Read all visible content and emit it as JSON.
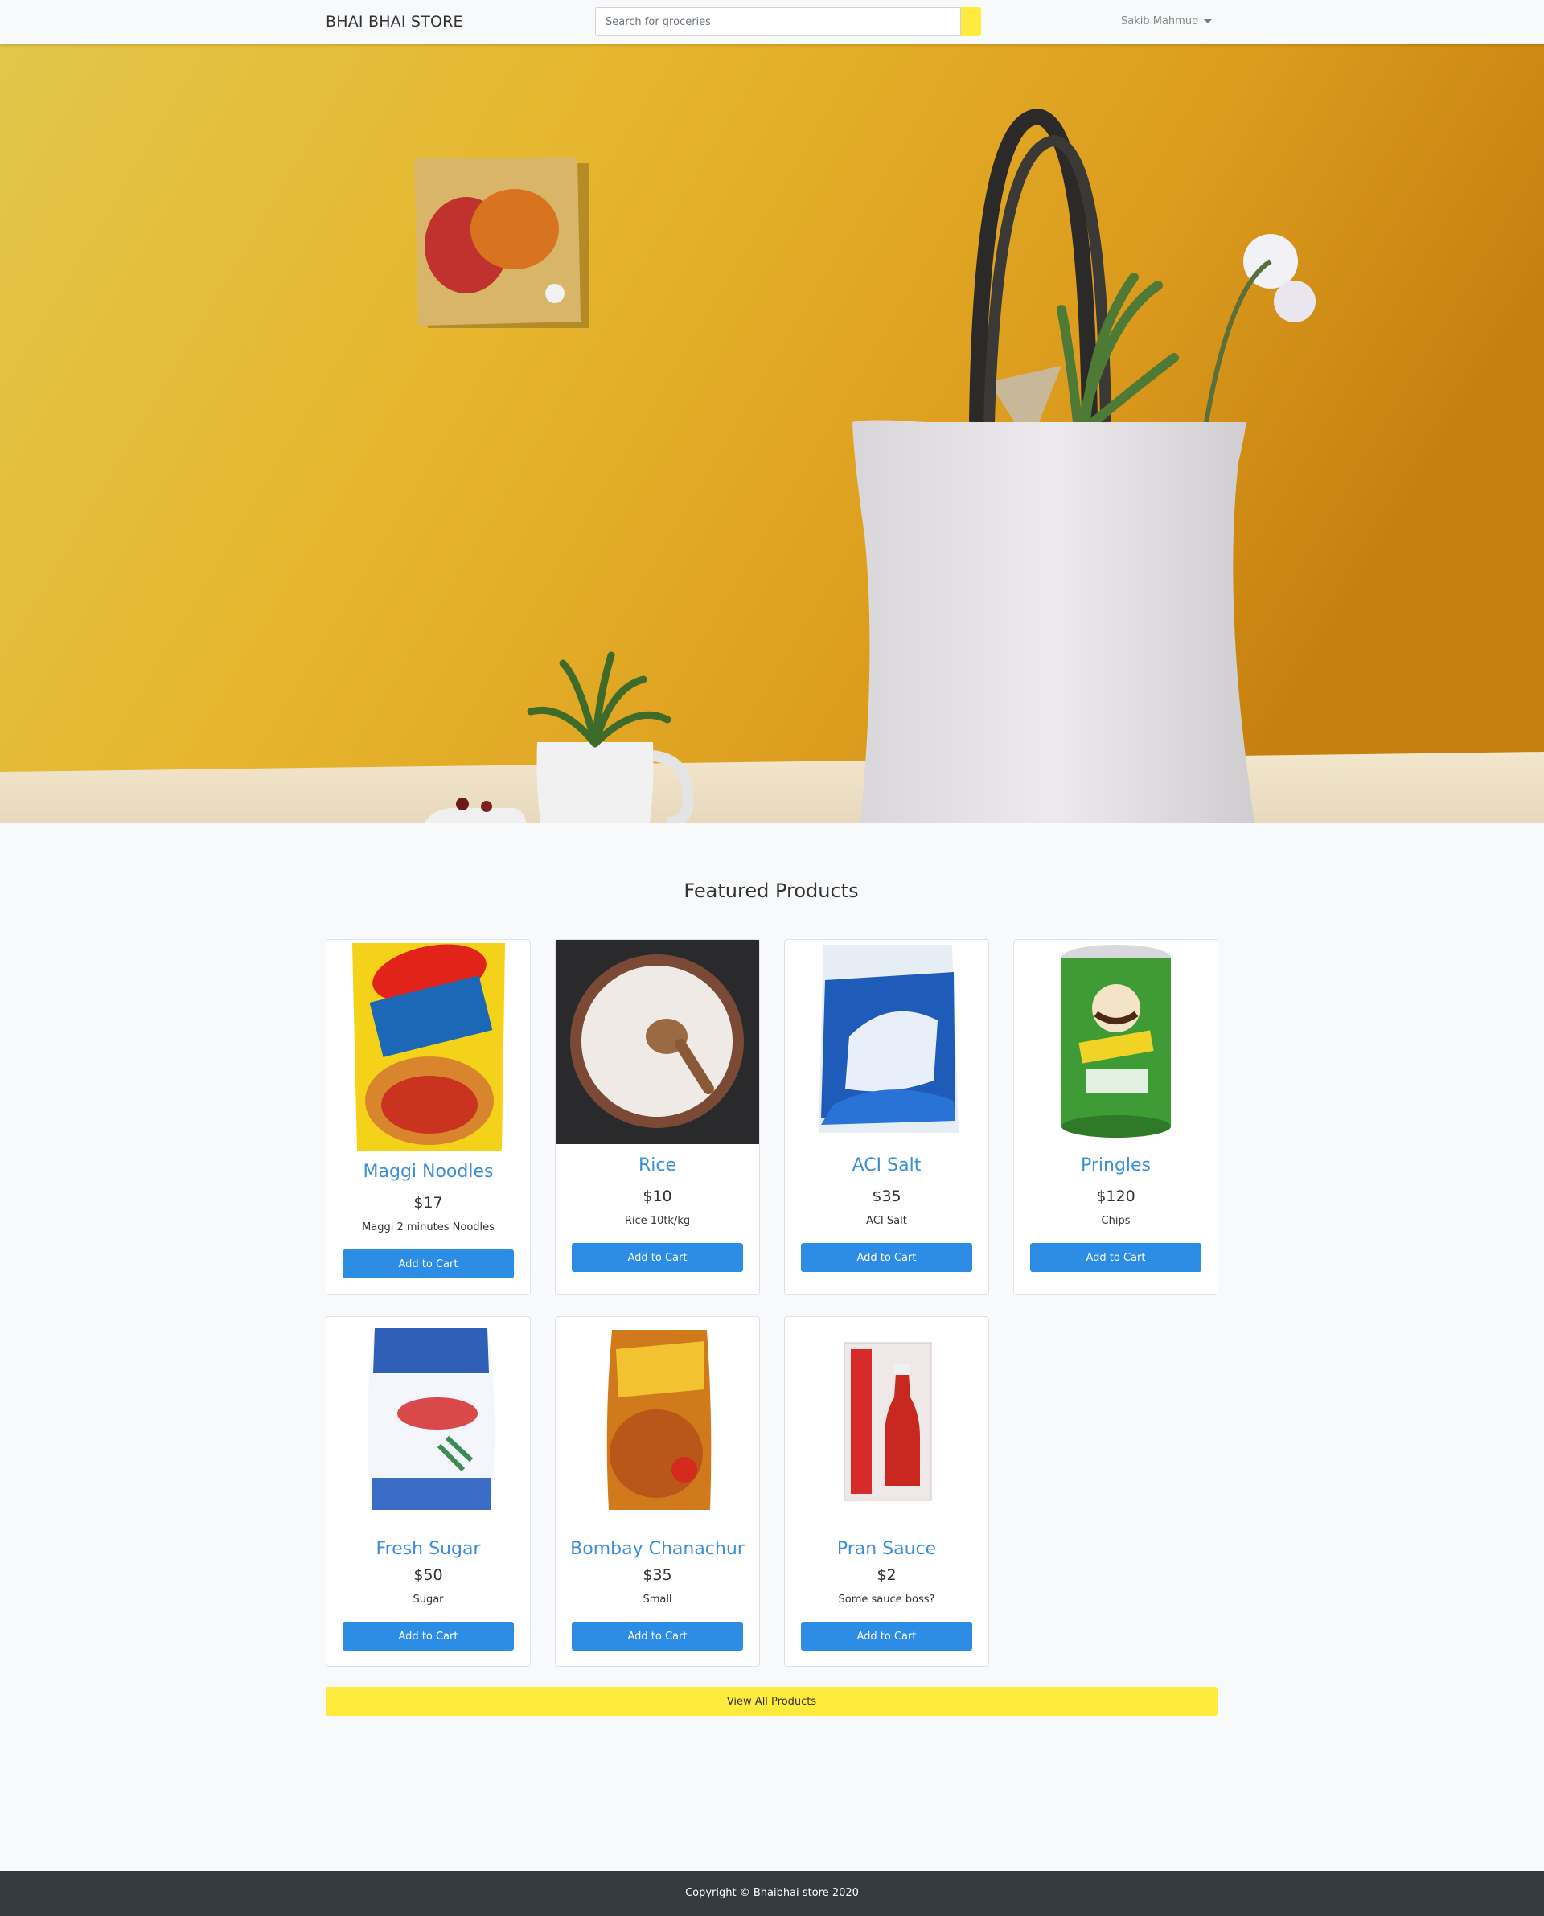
{
  "navbar": {
    "brand": "BHAI BHAI STORE",
    "search_placeholder": "Search for groceries",
    "user_name": "Sakib Mahmud"
  },
  "featured": {
    "title": "Featured Products",
    "add_to_cart_label": "Add to Cart",
    "view_all_label": "View All Products",
    "products": [
      {
        "name": "Maggi Noodles",
        "price": "$17",
        "desc": "Maggi 2 minutes Noodles",
        "image": "maggi-noodles-pack"
      },
      {
        "name": "Rice",
        "price": "$10",
        "desc": "Rice 10tk/kg",
        "image": "rice-bowl"
      },
      {
        "name": "ACI Salt",
        "price": "$35",
        "desc": "ACI Salt",
        "image": "aci-salt-pack"
      },
      {
        "name": "Pringles",
        "price": "$120",
        "desc": "Chips",
        "image": "pringles-can"
      },
      {
        "name": "Fresh Sugar",
        "price": "$50",
        "desc": "Sugar",
        "image": "fresh-sugar-pack"
      },
      {
        "name": "Bombay Chanachur",
        "price": "$35",
        "desc": "Small",
        "image": "chanachur-pack"
      },
      {
        "name": "Pran Sauce",
        "price": "$2",
        "desc": "Some sauce boss?",
        "image": "sauce-bottle"
      }
    ]
  },
  "footer": {
    "copyright": "Copyright © Bhaibhai store 2020"
  },
  "colors": {
    "accent_yellow": "#ffeb3b",
    "button_blue": "#2d8ce3",
    "link_blue": "#3b8ed8",
    "footer_bg": "#343a40"
  }
}
